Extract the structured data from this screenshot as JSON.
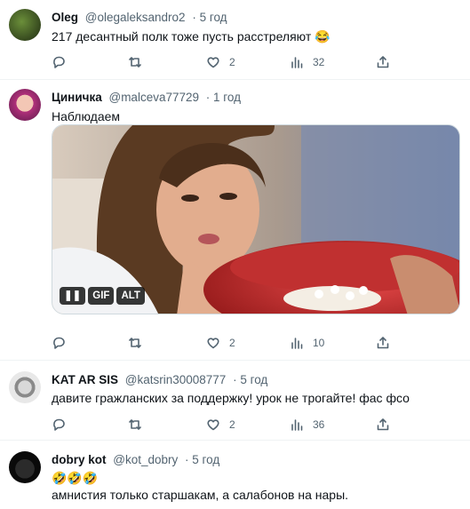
{
  "tweets": [
    {
      "author": "Oleg",
      "handle": "@olegaleksandro2",
      "time": "· 5 год",
      "text": "217 десантный полк тоже пусть расстреляют 😂",
      "replies": "",
      "retweets": "",
      "likes": "2",
      "views": "32"
    },
    {
      "author": "Циничка",
      "handle": "@malceva77729",
      "time": "· 1 год",
      "text": "Наблюдаем",
      "media": {
        "pause_label": "❚❚",
        "gif_label": "GIF",
        "alt_label": "ALT"
      },
      "replies": "",
      "retweets": "",
      "likes": "2",
      "views": "10"
    },
    {
      "author": "KAT AR SIS",
      "handle": "@katsrin30008777",
      "time": "· 5 год",
      "text": "давите гражланских за поддержку! урок не трогайте! фас фсо",
      "replies": "",
      "retweets": "",
      "likes": "2",
      "views": "36"
    },
    {
      "author": "dobry kot",
      "handle": "@kot_dobry",
      "time": "· 5 год",
      "text_line1": "🤣🤣🤣",
      "text_line2": "амнистия только старшакам, а салабонов на нары."
    }
  ],
  "icons": [
    "reply-icon",
    "retweet-icon",
    "like-icon",
    "views-icon",
    "share-icon"
  ]
}
